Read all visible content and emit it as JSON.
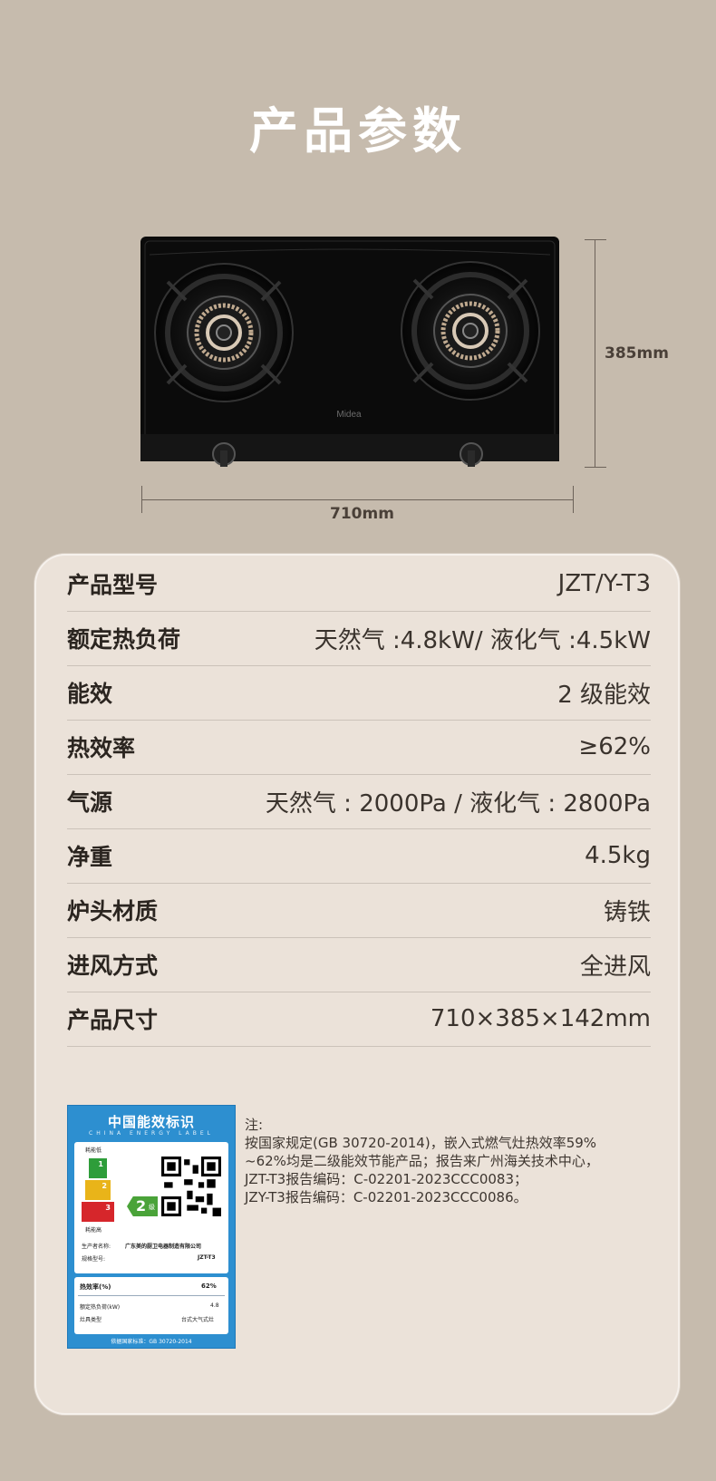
{
  "page_title": "产品参数",
  "dimensions": {
    "height_label": "385mm",
    "width_label": "710mm"
  },
  "stove": {
    "brand_logo_text": "Midea"
  },
  "specs": [
    {
      "label": "产品型号",
      "value": "JZT/Y-T3"
    },
    {
      "label": "额定热负荷",
      "value": "天然气 :4.8kW/ 液化气 :4.5kW"
    },
    {
      "label": "能效",
      "value": "2 级能效"
    },
    {
      "label": "热效率",
      "value": "≥62%"
    },
    {
      "label": "气源",
      "value": "天然气 : 2000Pa / 液化气 : 2800Pa"
    },
    {
      "label": "净重",
      "value": "4.5kg"
    },
    {
      "label": "炉头材质",
      "value": "铸铁"
    },
    {
      "label": "进风方式",
      "value": "全进风"
    },
    {
      "label": "产品尺寸",
      "value": "710×385×142mm"
    }
  ],
  "energy_label": {
    "title": "中国能效标识",
    "subtitle": "CHINA ENERGY LABEL",
    "low_consumption": "耗能低",
    "high_consumption": "耗能高",
    "grade": "2",
    "grade_suffix": "级",
    "manufacturer_label": "生产者名称:",
    "manufacturer": "广东美的厨卫电器制造有限公司",
    "model_label": "规格型号:",
    "model": "JZT-T3",
    "efficiency_label": "热效率(%)",
    "efficiency": "62%",
    "load_label": "额定热负荷(kW)",
    "load": "4.8",
    "type_label": "灶具类型",
    "type": "台式大气式灶",
    "standard": "依据国家标准：GB 30720-2014"
  },
  "note": {
    "title": "注:",
    "lines": [
      "按国家规定(GB 30720-2014)，嵌入式燃气灶热效率59%",
      "~62%均是二级能效节能产品；报告来广州海关技术中心，",
      "JZT-T3报告编码：C-02201-2023CCC0083；",
      "JZY-T3报告编码：C-02201-2023CCC0086。"
    ]
  }
}
